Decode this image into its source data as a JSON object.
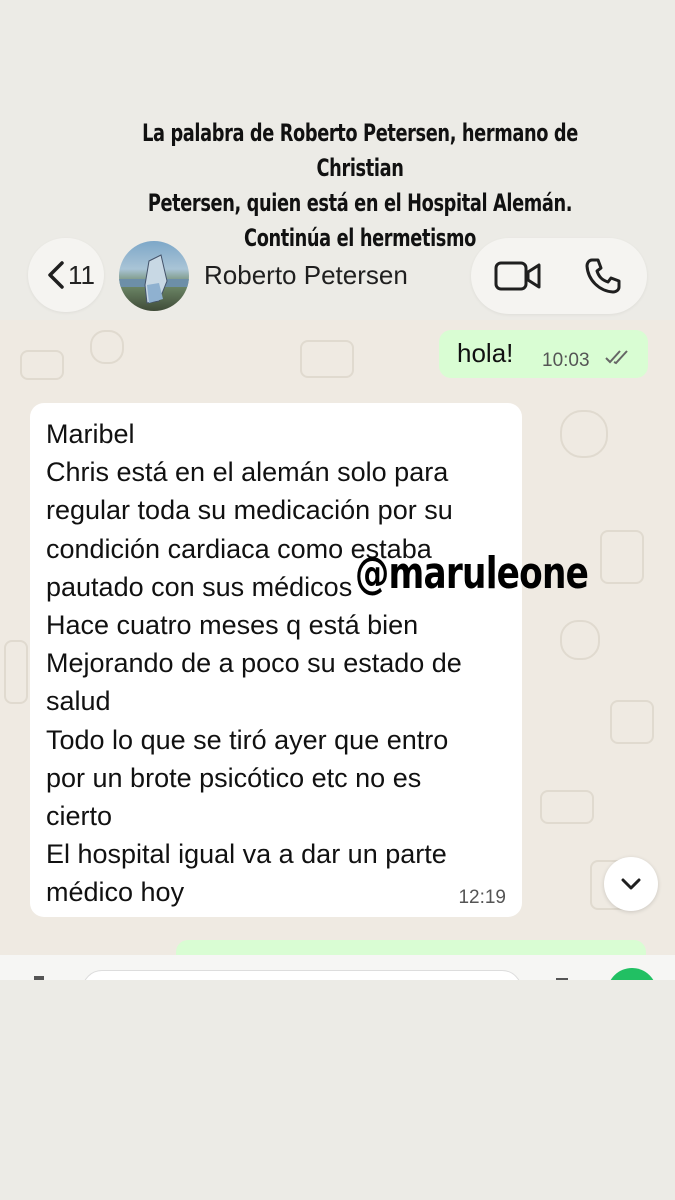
{
  "caption": {
    "line1": "La palabra de Roberto Petersen, hermano de Christian",
    "line2": "Petersen, quien está en el Hospital Alemán.",
    "line3": "Continúa el hermetismo"
  },
  "header": {
    "back_count": "11",
    "contact_name": "Roberto Petersen"
  },
  "messages": [
    {
      "direction": "outgoing",
      "text": "hola!",
      "time": "10:03",
      "status": "read"
    },
    {
      "direction": "incoming",
      "lines": [
        "Maribel",
        "Chris está en el alemán solo para",
        "regular toda su medicación por su",
        "condición cardiaca  como estaba",
        "pautado con sus médicos",
        "Hace cuatro meses q está bien",
        "Mejorando de a poco su estado de",
        "salud",
        "Todo lo que se tiró ayer que entro",
        "por un brote psicótico etc no es",
        "cierto",
        "El hospital igual va a dar un parte",
        "médico hoy"
      ],
      "time": "12:19"
    }
  ],
  "watermark": "@maruleone",
  "colors": {
    "outgoing_bubble": "#d9fdd3",
    "incoming_bubble": "#ffffff",
    "chat_background": "#efeae2",
    "page_background": "#ecebe6",
    "accent_green": "#21c063"
  },
  "icons": [
    "chevron-left-icon",
    "video-call-icon",
    "phone-icon",
    "double-check-icon",
    "chevron-down-icon"
  ]
}
